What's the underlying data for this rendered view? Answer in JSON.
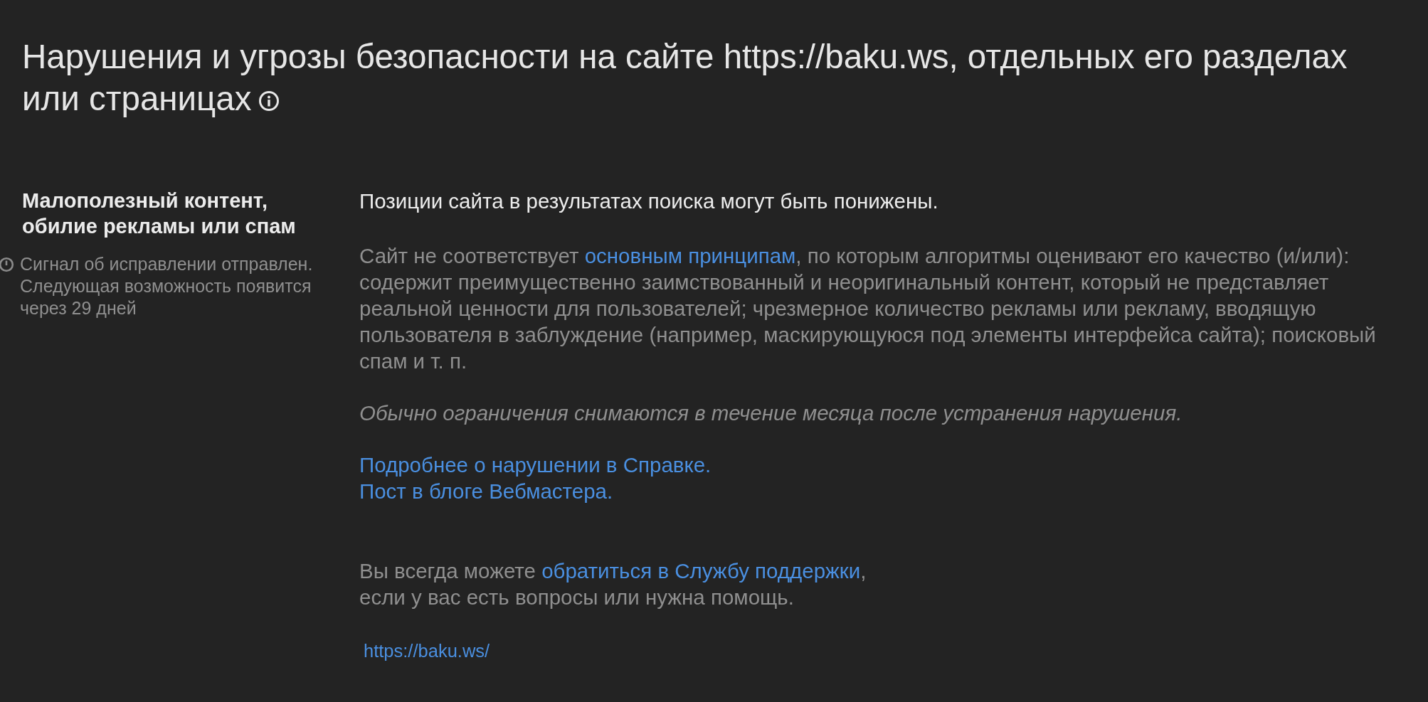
{
  "title_lines": [
    "Нарушения и угрозы безопасности на сайте https://baku.ws, отдельных его разделах",
    "или страницах"
  ],
  "violation": {
    "heading": "Малополезный контент, обилие рекламы или спам",
    "status": "Сигнал об исправлении отправлен. Следующая возможность появится через 29 дней"
  },
  "lead": "Позиции сайта в результатах поиска могут быть понижены.",
  "description": {
    "before": "Сайт не соответствует ",
    "link": "основным принципам",
    "after": ", по которым алгоритмы оценивают его качество (и/или): содержит преимущественно заимствованный и неоригинальный контент, который не представляет реальной ценности для пользователей; чрезмерное количество рекламы или рекламу, вводящую пользователя в заблуждение (например, маскирующуюся под элементы интерфейса сайта); поисковый спам и т. п."
  },
  "note": "Обычно ограничения снимаются в течение месяца после устранения нарушения.",
  "links": [
    "Подробнее о нарушении в Справке.",
    "Пост в блоге Вебмастера."
  ],
  "support": {
    "before": "Вы всегда можете ",
    "link": "обратиться в Службу поддержки",
    "after": ",",
    "second_line": "если у вас есть вопросы или нужна помощь."
  },
  "site_url": "https://baku.ws/"
}
